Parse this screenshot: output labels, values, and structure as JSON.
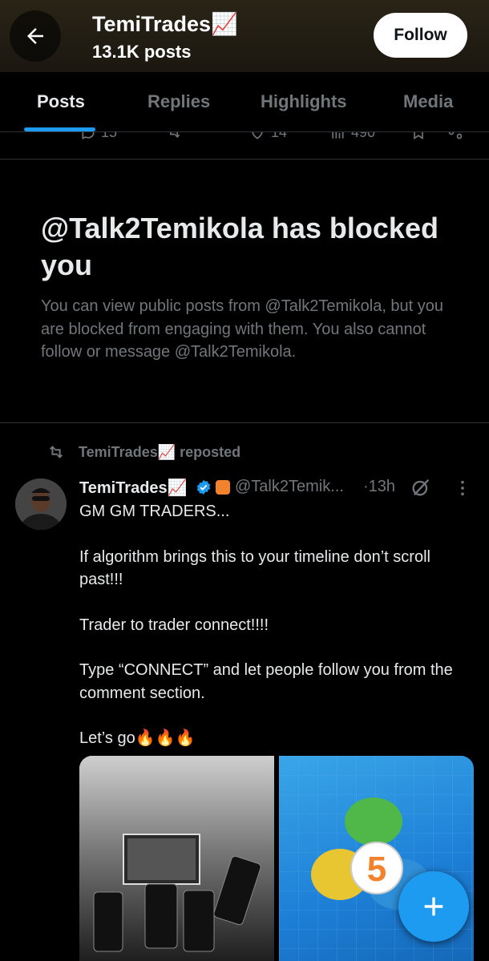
{
  "header": {
    "name": "TemiTrades📈",
    "posts_count": "13.1K posts",
    "follow_label": "Follow"
  },
  "tabs": [
    {
      "label": "Posts",
      "active": true
    },
    {
      "label": "Replies",
      "active": false
    },
    {
      "label": "Highlights",
      "active": false
    },
    {
      "label": "Media",
      "active": false
    }
  ],
  "prev_post_stats": {
    "replies": "15",
    "likes": "14",
    "views": "490"
  },
  "blocked_notice": {
    "title": "@Talk2Temikola has blocked you",
    "description": "You can view public posts from @Talk2Temikola, but you are blocked from engaging with them. You also cannot follow or message @Talk2Temikola."
  },
  "post": {
    "repost_label": "TemiTrades📈 reposted",
    "author_name": "TemiTrades📈",
    "handle": "@Talk2Temik...",
    "time": "·13h",
    "body": [
      "GM GM TRADERS...",
      "",
      "If algorithm brings this to your timeline don’t scroll past!!!",
      "",
      "Trader to trader connect!!!!",
      "",
      "Type “CONNECT” and let people follow you from the comment section.",
      "",
      "Let’s go🔥🔥🔥"
    ],
    "mt5_badge_digit": "5"
  },
  "colors": {
    "accent": "#1d9bf0",
    "muted": "#71767b",
    "text": "#e7e9ea",
    "background": "#000000",
    "header_bg": "#2a2417"
  },
  "icons": [
    "back-arrow-icon",
    "verified-icon",
    "affiliate-badge-icon",
    "grok-icon",
    "more-icon",
    "repost-icon",
    "plus-icon"
  ]
}
